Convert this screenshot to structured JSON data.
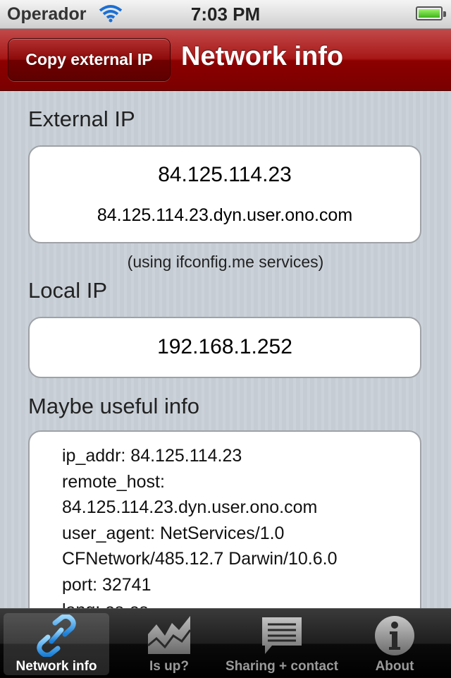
{
  "status_bar": {
    "carrier": "Operador",
    "time": "7:03 PM"
  },
  "nav": {
    "copy_button": "Copy external IP",
    "title": "Network info"
  },
  "external_ip": {
    "heading": "External IP",
    "ip": "84.125.114.23",
    "host": "84.125.114.23.dyn.user.ono.com",
    "note": "(using ifconfig.me services)"
  },
  "local_ip": {
    "heading": "Local IP",
    "ip": "192.168.1.252"
  },
  "useful_info": {
    "heading": "Maybe useful info",
    "lines": [
      "ip_addr: 84.125.114.23",
      "remote_host:",
      "84.125.114.23.dyn.user.ono.com",
      "user_agent: NetServices/1.0",
      "CFNetwork/485.12.7 Darwin/10.6.0",
      "port: 32741",
      "lang: es-es"
    ]
  },
  "tabs": [
    {
      "label": "Network info",
      "icon": "chain-link-icon",
      "active": true
    },
    {
      "label": "Is up?",
      "icon": "chart-icon",
      "active": false
    },
    {
      "label": "Sharing + contact",
      "icon": "speech-bubble-icon",
      "active": false
    },
    {
      "label": "About",
      "icon": "info-icon",
      "active": false
    }
  ]
}
